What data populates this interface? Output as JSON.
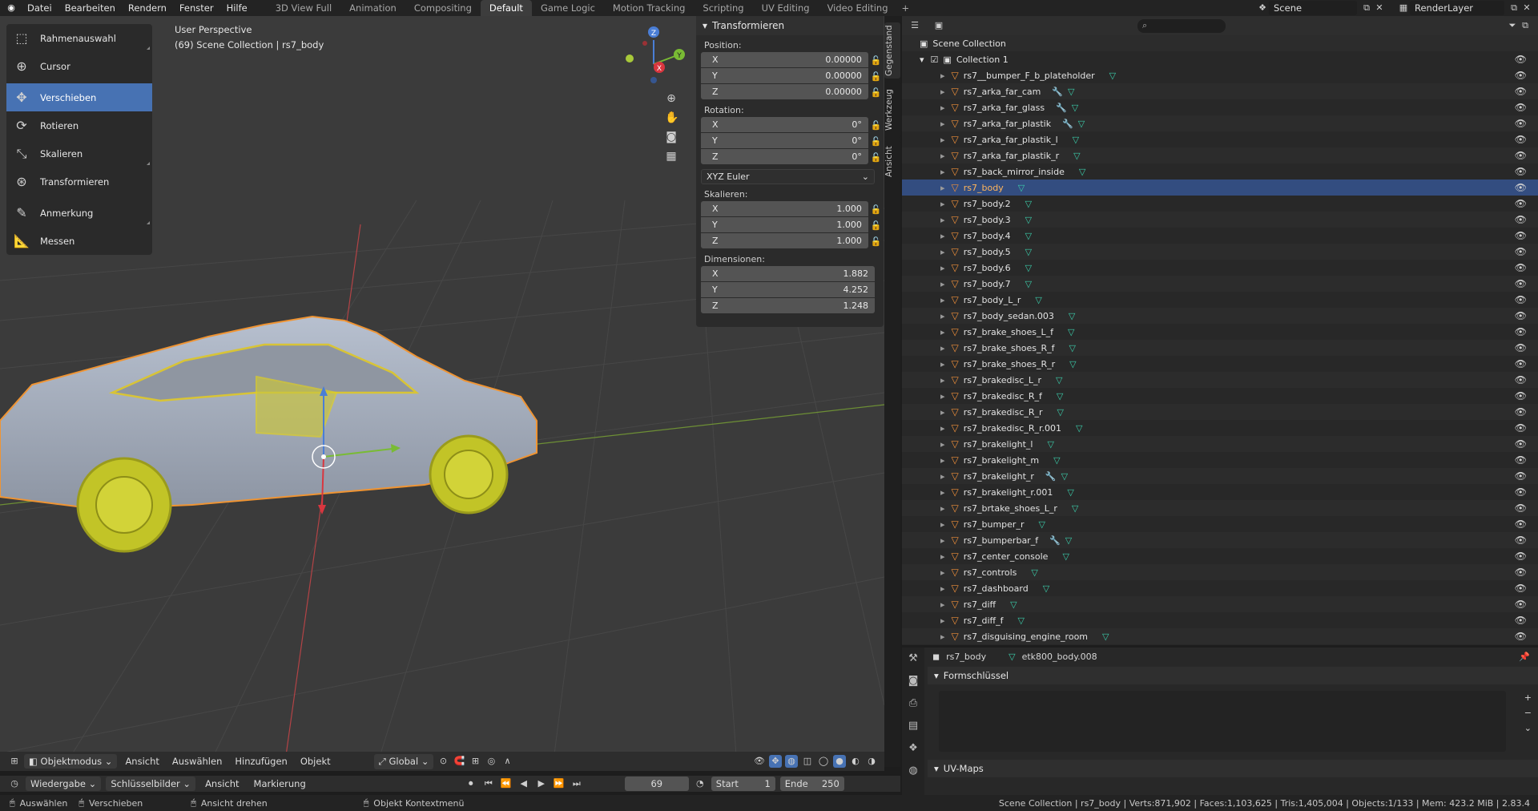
{
  "topbar": {
    "menus": [
      "Datei",
      "Bearbeiten",
      "Rendern",
      "Fenster",
      "Hilfe"
    ],
    "workspaces": [
      "3D View Full",
      "Animation",
      "Compositing",
      "Default",
      "Game Logic",
      "Motion Tracking",
      "Scripting",
      "UV Editing",
      "Video Editing"
    ],
    "active_workspace": "Default",
    "scene": "Scene",
    "render_layer": "RenderLayer"
  },
  "toolbar": {
    "tools": [
      "Rahmenauswahl",
      "Cursor",
      "Verschieben",
      "Rotieren",
      "Skalieren",
      "Transformieren",
      "Anmerkung",
      "Messen"
    ],
    "active": "Verschieben"
  },
  "viewport": {
    "perspective": "User Perspective",
    "collection_info": "(69) Scene Collection | rs7_body",
    "gizmo": {
      "x": "X",
      "y": "Y",
      "z": "Z"
    }
  },
  "npanel": {
    "title": "Transformieren",
    "position_label": "Position:",
    "position": [
      {
        "axis": "X",
        "value": "0.00000"
      },
      {
        "axis": "Y",
        "value": "0.00000"
      },
      {
        "axis": "Z",
        "value": "0.00000"
      }
    ],
    "rotation_label": "Rotation:",
    "rotation": [
      {
        "axis": "X",
        "value": "0°"
      },
      {
        "axis": "Y",
        "value": "0°"
      },
      {
        "axis": "Z",
        "value": "0°"
      }
    ],
    "rotation_mode": "XYZ Euler",
    "scale_label": "Skalieren:",
    "scale": [
      {
        "axis": "X",
        "value": "1.000"
      },
      {
        "axis": "Y",
        "value": "1.000"
      },
      {
        "axis": "Z",
        "value": "1.000"
      }
    ],
    "dimensions_label": "Dimensionen:",
    "dimensions": [
      {
        "axis": "X",
        "value": "1.882"
      },
      {
        "axis": "Y",
        "value": "4.252"
      },
      {
        "axis": "Z",
        "value": "1.248"
      }
    ],
    "side_tabs": [
      "Gegenstand",
      "Werkzeug",
      "Ansicht"
    ]
  },
  "vp_header": {
    "mode": "Objektmodus",
    "menus": [
      "Ansicht",
      "Auswählen",
      "Hinzufügen",
      "Objekt"
    ],
    "orientation": "Global"
  },
  "timeline": {
    "menus": [
      "Wiedergabe",
      "Schlüsselbilder",
      "Ansicht",
      "Markierung"
    ],
    "current_frame": "69",
    "start_label": "Start",
    "start": "1",
    "end_label": "Ende",
    "end": "250"
  },
  "statusbar": {
    "select": "Auswählen",
    "move": "Verschieben",
    "rotate_view": "Ansicht drehen",
    "context": "Objekt Kontextmenü",
    "info": "Scene Collection | rs7_body | Verts:871,902 | Faces:1,103,625 | Tris:1,405,004 | Objects:1/133 | Mem: 423.2 MiB | 2.83.4"
  },
  "outliner": {
    "scene_collection": "Scene Collection",
    "collection": "Collection 1",
    "items": [
      {
        "name": "rs7__bumper_F_b_plateholder",
        "wrench": false
      },
      {
        "name": "rs7_arka_far_cam",
        "wrench": true
      },
      {
        "name": "rs7_arka_far_glass",
        "wrench": true
      },
      {
        "name": "rs7_arka_far_plastik",
        "wrench": true
      },
      {
        "name": "rs7_arka_far_plastik_l",
        "wrench": false
      },
      {
        "name": "rs7_arka_far_plastik_r",
        "wrench": false
      },
      {
        "name": "rs7_back_mirror_inside",
        "wrench": false
      },
      {
        "name": "rs7_body",
        "wrench": false,
        "selected": true
      },
      {
        "name": "rs7_body.2",
        "wrench": false
      },
      {
        "name": "rs7_body.3",
        "wrench": false
      },
      {
        "name": "rs7_body.4",
        "wrench": false
      },
      {
        "name": "rs7_body.5",
        "wrench": false
      },
      {
        "name": "rs7_body.6",
        "wrench": false
      },
      {
        "name": "rs7_body.7",
        "wrench": false
      },
      {
        "name": "rs7_body_L_r",
        "wrench": false
      },
      {
        "name": "rs7_body_sedan.003",
        "wrench": false
      },
      {
        "name": "rs7_brake_shoes_L_f",
        "wrench": false
      },
      {
        "name": "rs7_brake_shoes_R_f",
        "wrench": false
      },
      {
        "name": "rs7_brake_shoes_R_r",
        "wrench": false
      },
      {
        "name": "rs7_brakedisc_L_r",
        "wrench": false
      },
      {
        "name": "rs7_brakedisc_R_f",
        "wrench": false
      },
      {
        "name": "rs7_brakedisc_R_r",
        "wrench": false
      },
      {
        "name": "rs7_brakedisc_R_r.001",
        "wrench": false
      },
      {
        "name": "rs7_brakelight_l",
        "wrench": false
      },
      {
        "name": "rs7_brakelight_m",
        "wrench": false
      },
      {
        "name": "rs7_brakelight_r",
        "wrench": true
      },
      {
        "name": "rs7_brakelight_r.001",
        "wrench": false
      },
      {
        "name": "rs7_brtake_shoes_L_r",
        "wrench": false
      },
      {
        "name": "rs7_bumper_r",
        "wrench": false
      },
      {
        "name": "rs7_bumperbar_f",
        "wrench": true
      },
      {
        "name": "rs7_center_console",
        "wrench": false
      },
      {
        "name": "rs7_controls",
        "wrench": false
      },
      {
        "name": "rs7_dashboard",
        "wrench": false
      },
      {
        "name": "rs7_diff",
        "wrench": false
      },
      {
        "name": "rs7_diff_f",
        "wrench": false
      },
      {
        "name": "rs7_disguising_engine_room",
        "wrench": false
      }
    ]
  },
  "properties": {
    "object": "rs7_body",
    "mesh": "etk800_body.008",
    "shape_keys": "Formschlüssel",
    "uv_maps": "UV-Maps"
  }
}
